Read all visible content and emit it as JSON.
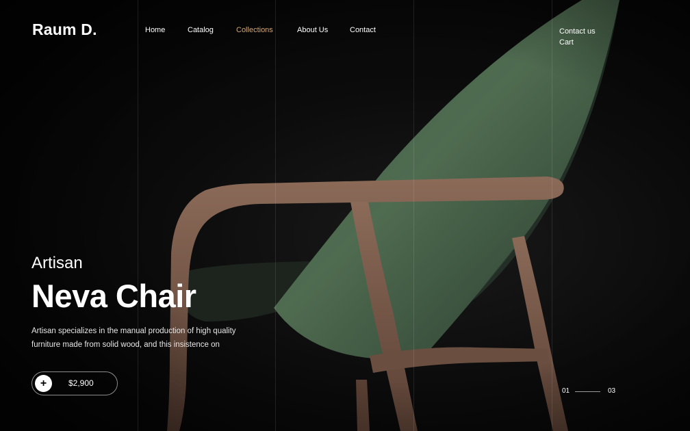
{
  "brand": {
    "logo": "Raum D."
  },
  "nav": {
    "items": [
      {
        "label": "Home",
        "active": false
      },
      {
        "label": "Catalog",
        "active": false
      },
      {
        "label": "Collections",
        "active": true
      },
      {
        "label": "About Us",
        "active": false
      },
      {
        "label": "Contact",
        "active": false
      }
    ],
    "accent_color": "#d2a778"
  },
  "header_right": {
    "contact": "Contact us",
    "cart": "Cart"
  },
  "hero": {
    "subtitle": "Artisan",
    "title": "Neva Chair",
    "description_line1": "Artisan specializes in the manual production of high quality",
    "description_line2": "furniture made from solid wood, and this insistence on",
    "price": "$2,900",
    "add_icon": "plus-icon"
  },
  "slider": {
    "current": "01",
    "total": "03"
  }
}
